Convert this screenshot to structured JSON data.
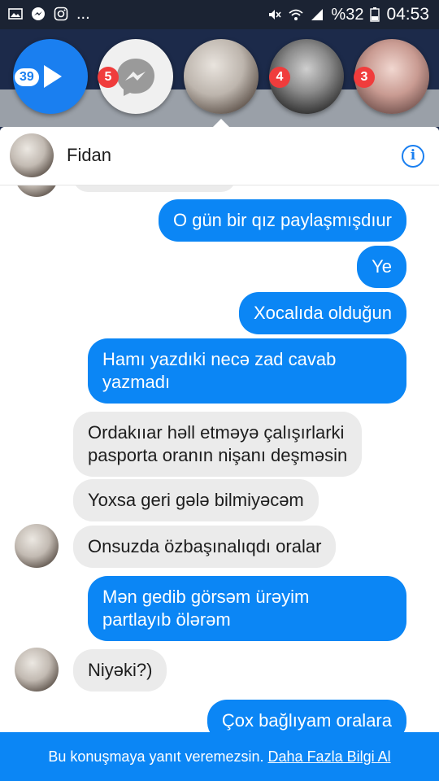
{
  "status_bar": {
    "battery": "%32",
    "time": "04:53"
  },
  "chat_heads": [
    {
      "id": "play",
      "badge": "39"
    },
    {
      "id": "messenger",
      "badge": "5"
    },
    {
      "id": "fidan",
      "badge": ""
    },
    {
      "id": "girl1",
      "badge": "4"
    },
    {
      "id": "girl2",
      "badge": "3"
    }
  ],
  "chat": {
    "contact_name": "Fidan",
    "messages": [
      {
        "dir": "out",
        "text": "O gün bir qız paylaşmışdıur"
      },
      {
        "dir": "out",
        "text": "Ye"
      },
      {
        "dir": "out",
        "text": "Xocalıda olduğun"
      },
      {
        "dir": "out",
        "lines": [
          "Hamı yazdıki necə zad cavab",
          "yazmadı"
        ]
      },
      {
        "dir": "in",
        "lines": [
          "Ordakııar həll etməyə çalışırlarki",
          "pasporta oranın nişanı deşməsin"
        ]
      },
      {
        "dir": "in",
        "text": "Yoxsa geri gələ bilmiyəcəm"
      },
      {
        "dir": "in",
        "text": "Onsuzda özbaşınalıqdı oralar"
      },
      {
        "dir": "out",
        "lines": [
          "Mən gedib görsəm ürəyim",
          "partlayıb ölərəm"
        ]
      },
      {
        "dir": "in",
        "text": "Niyəki?)"
      },
      {
        "dir": "out",
        "text": "Çox bağlıyam oralara"
      }
    ]
  },
  "bottom_bar": {
    "notice": "Bu konuşmaya yanıt veremezsin.",
    "link": "Daha Fazla Bilgi Al"
  },
  "colors": {
    "accent": "#0b86f5",
    "incoming_bubble": "#ebebeb",
    "badge_red": "#f03c3c"
  }
}
